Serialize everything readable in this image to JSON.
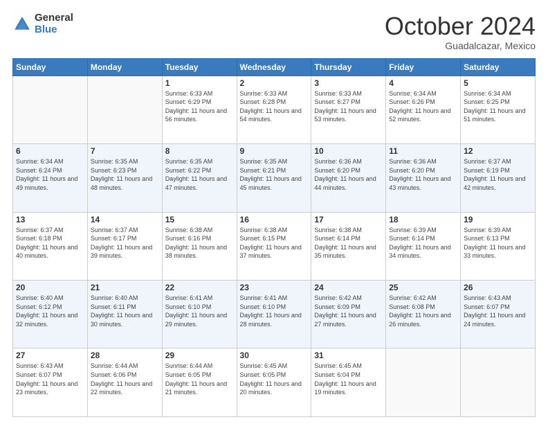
{
  "header": {
    "logo_general": "General",
    "logo_blue": "Blue",
    "month_title": "October 2024",
    "subtitle": "Guadalcazar, Mexico"
  },
  "days_of_week": [
    "Sunday",
    "Monday",
    "Tuesday",
    "Wednesday",
    "Thursday",
    "Friday",
    "Saturday"
  ],
  "weeks": [
    [
      {
        "day": "",
        "info": ""
      },
      {
        "day": "",
        "info": ""
      },
      {
        "day": "1",
        "info": "Sunrise: 6:33 AM\nSunset: 6:29 PM\nDaylight: 11 hours and 56 minutes."
      },
      {
        "day": "2",
        "info": "Sunrise: 6:33 AM\nSunset: 6:28 PM\nDaylight: 11 hours and 54 minutes."
      },
      {
        "day": "3",
        "info": "Sunrise: 6:33 AM\nSunset: 6:27 PM\nDaylight: 11 hours and 53 minutes."
      },
      {
        "day": "4",
        "info": "Sunrise: 6:34 AM\nSunset: 6:26 PM\nDaylight: 11 hours and 52 minutes."
      },
      {
        "day": "5",
        "info": "Sunrise: 6:34 AM\nSunset: 6:25 PM\nDaylight: 11 hours and 51 minutes."
      }
    ],
    [
      {
        "day": "6",
        "info": "Sunrise: 6:34 AM\nSunset: 6:24 PM\nDaylight: 11 hours and 49 minutes."
      },
      {
        "day": "7",
        "info": "Sunrise: 6:35 AM\nSunset: 6:23 PM\nDaylight: 11 hours and 48 minutes."
      },
      {
        "day": "8",
        "info": "Sunrise: 6:35 AM\nSunset: 6:22 PM\nDaylight: 11 hours and 47 minutes."
      },
      {
        "day": "9",
        "info": "Sunrise: 6:35 AM\nSunset: 6:21 PM\nDaylight: 11 hours and 45 minutes."
      },
      {
        "day": "10",
        "info": "Sunrise: 6:36 AM\nSunset: 6:20 PM\nDaylight: 11 hours and 44 minutes."
      },
      {
        "day": "11",
        "info": "Sunrise: 6:36 AM\nSunset: 6:20 PM\nDaylight: 11 hours and 43 minutes."
      },
      {
        "day": "12",
        "info": "Sunrise: 6:37 AM\nSunset: 6:19 PM\nDaylight: 11 hours and 42 minutes."
      }
    ],
    [
      {
        "day": "13",
        "info": "Sunrise: 6:37 AM\nSunset: 6:18 PM\nDaylight: 11 hours and 40 minutes."
      },
      {
        "day": "14",
        "info": "Sunrise: 6:37 AM\nSunset: 6:17 PM\nDaylight: 11 hours and 39 minutes."
      },
      {
        "day": "15",
        "info": "Sunrise: 6:38 AM\nSunset: 6:16 PM\nDaylight: 11 hours and 38 minutes."
      },
      {
        "day": "16",
        "info": "Sunrise: 6:38 AM\nSunset: 6:15 PM\nDaylight: 11 hours and 37 minutes."
      },
      {
        "day": "17",
        "info": "Sunrise: 6:38 AM\nSunset: 6:14 PM\nDaylight: 11 hours and 35 minutes."
      },
      {
        "day": "18",
        "info": "Sunrise: 6:39 AM\nSunset: 6:14 PM\nDaylight: 11 hours and 34 minutes."
      },
      {
        "day": "19",
        "info": "Sunrise: 6:39 AM\nSunset: 6:13 PM\nDaylight: 11 hours and 33 minutes."
      }
    ],
    [
      {
        "day": "20",
        "info": "Sunrise: 6:40 AM\nSunset: 6:12 PM\nDaylight: 11 hours and 32 minutes."
      },
      {
        "day": "21",
        "info": "Sunrise: 6:40 AM\nSunset: 6:11 PM\nDaylight: 11 hours and 30 minutes."
      },
      {
        "day": "22",
        "info": "Sunrise: 6:41 AM\nSunset: 6:10 PM\nDaylight: 11 hours and 29 minutes."
      },
      {
        "day": "23",
        "info": "Sunrise: 6:41 AM\nSunset: 6:10 PM\nDaylight: 11 hours and 28 minutes."
      },
      {
        "day": "24",
        "info": "Sunrise: 6:42 AM\nSunset: 6:09 PM\nDaylight: 11 hours and 27 minutes."
      },
      {
        "day": "25",
        "info": "Sunrise: 6:42 AM\nSunset: 6:08 PM\nDaylight: 11 hours and 26 minutes."
      },
      {
        "day": "26",
        "info": "Sunrise: 6:43 AM\nSunset: 6:07 PM\nDaylight: 11 hours and 24 minutes."
      }
    ],
    [
      {
        "day": "27",
        "info": "Sunrise: 6:43 AM\nSunset: 6:07 PM\nDaylight: 11 hours and 23 minutes."
      },
      {
        "day": "28",
        "info": "Sunrise: 6:44 AM\nSunset: 6:06 PM\nDaylight: 11 hours and 22 minutes."
      },
      {
        "day": "29",
        "info": "Sunrise: 6:44 AM\nSunset: 6:05 PM\nDaylight: 11 hours and 21 minutes."
      },
      {
        "day": "30",
        "info": "Sunrise: 6:45 AM\nSunset: 6:05 PM\nDaylight: 11 hours and 20 minutes."
      },
      {
        "day": "31",
        "info": "Sunrise: 6:45 AM\nSunset: 6:04 PM\nDaylight: 11 hours and 19 minutes."
      },
      {
        "day": "",
        "info": ""
      },
      {
        "day": "",
        "info": ""
      }
    ]
  ]
}
